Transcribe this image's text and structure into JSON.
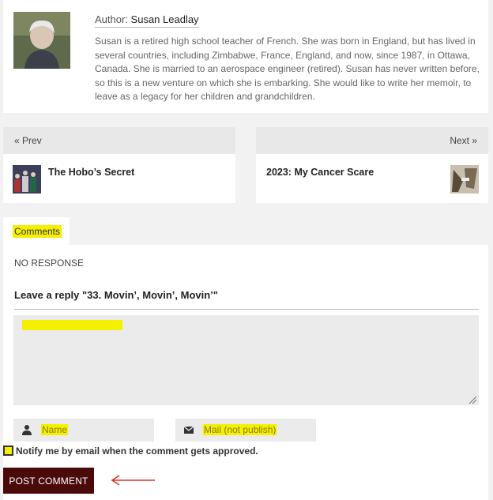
{
  "author": {
    "label": "Author:",
    "name": "Susan Leadlay",
    "bio": "Susan is a retired high school teacher of French. She was born in England, but has lived in several countries, including Zimbabwe, France, England, and now, since 1987, in Ottawa, Canada. She is married to an aerospace engineer (retired). Susan has never written before, so this is a new venture on which she is embarking. She would like to write her memoir, to leave as a legacy for her children and grandchildren."
  },
  "nav": {
    "prev_label": "« Prev",
    "prev_title": "The Hobo’s Secret",
    "next_label": "Next »",
    "next_title": "2023: My Cancer Scare"
  },
  "comments": {
    "tab_label": "Comments",
    "no_response": "NO RESPONSE",
    "reply_title": "Leave a reply \"33. Movin’, Movin’, Movin’\"",
    "name_placeholder": "Name",
    "mail_placeholder": "Mail (not publish)",
    "notify_label": "Notify me by email when the comment gets approved.",
    "post_label": "POST COMMENT"
  },
  "colors": {
    "highlight": "#f5ef00",
    "post_button": "#4a0a0a",
    "arrow": "#e0322c"
  },
  "icons": {
    "name_field": "user-icon",
    "mail_field": "envelope-icon"
  }
}
